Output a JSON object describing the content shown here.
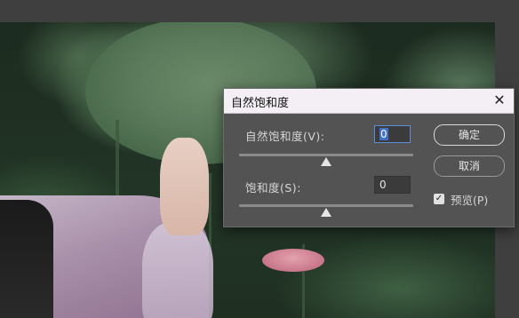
{
  "dialog": {
    "title": "自然饱和度",
    "close_glyph": "✕",
    "vibrance": {
      "label": "自然饱和度(V):",
      "value": "0"
    },
    "saturation": {
      "label": "饱和度(S):",
      "value": "0"
    },
    "ok_label": "确定",
    "cancel_label": "取消",
    "preview": {
      "label": "预览(P)",
      "checked": true,
      "check_glyph": "✓"
    }
  },
  "colors": {
    "dialog_bg": "#535353",
    "titlebar_bg": "#f3eff5",
    "focus_border": "#5b8ed6"
  },
  "icons": [
    "close-icon",
    "checkmark-icon",
    "slider-thumb-icon"
  ]
}
